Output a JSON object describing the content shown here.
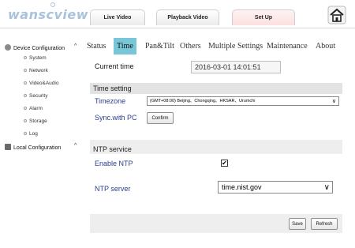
{
  "brand": {
    "logo_text": "wanscview",
    "accent": "#79c6d8",
    "logo_color": "#a9c3dc"
  },
  "nav": {
    "tabs": [
      {
        "label": "Live Video"
      },
      {
        "label": "Playback Video"
      },
      {
        "label": "Set Up"
      }
    ],
    "home_icon": "home-icon"
  },
  "sidebar": {
    "device_group": "Device Configuration",
    "items": [
      {
        "label": "System"
      },
      {
        "label": "Network"
      },
      {
        "label": "Video&Audio"
      },
      {
        "label": "Security"
      },
      {
        "label": "Alarm"
      },
      {
        "label": "Storage"
      },
      {
        "label": "Log"
      }
    ],
    "local_group": "Local Configuration"
  },
  "subtabs": [
    {
      "label": "Status"
    },
    {
      "label": "Time"
    },
    {
      "label": "Pan&Tilt"
    },
    {
      "label": "Others"
    },
    {
      "label": "Multiple Settings"
    },
    {
      "label": "Maintenance"
    },
    {
      "label": "About"
    }
  ],
  "time": {
    "current_label": "Current time",
    "current_value": "2016-03-01  14:01:51",
    "setting_header": "Time setting",
    "timezone_label": "Timezone",
    "timezone_value": "(GMT+08:00) Beijing、Chongqing、HKSAR、Urumchi",
    "sync_label": "Sync.with PC",
    "confirm_label": "Confirm"
  },
  "ntp": {
    "header": "NTP service",
    "enable_label": "Enable NTP",
    "enabled": true,
    "check_mark": "✔",
    "server_label": "NTP server",
    "server_value": "time.nist.gov"
  },
  "footer": {
    "save_label": "Save",
    "refresh_label": "Refresh"
  },
  "colors": {
    "label_blue": "#2a3d8f",
    "label_dark": "#1a1a1a"
  }
}
